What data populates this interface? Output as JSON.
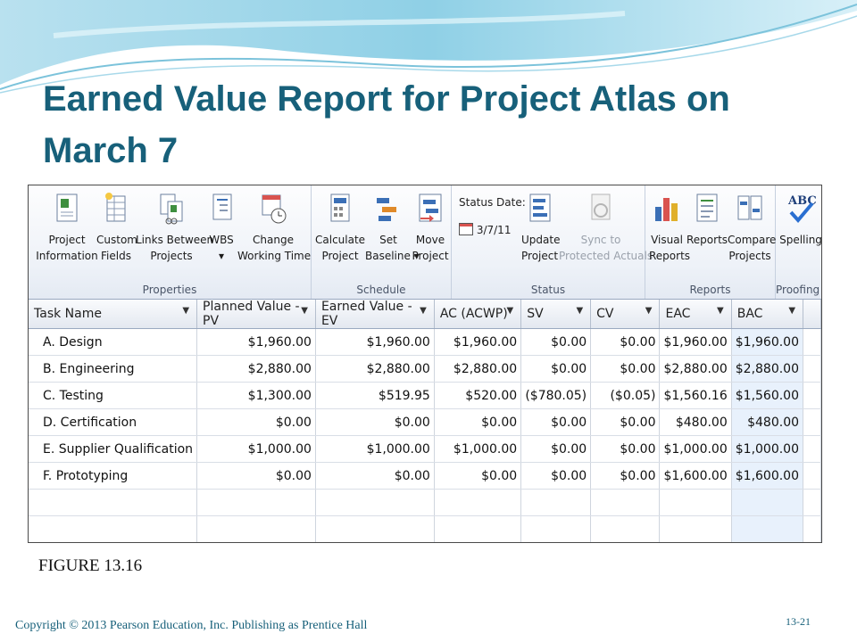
{
  "slide": {
    "title_line1": "Earned Value Report for Project Atlas on",
    "title_line2": "March 7",
    "figure": "FIGURE 13.16",
    "copyright": "Copyright © 2013 Pearson Education, Inc. Publishing as Prentice Hall",
    "page": "13-21"
  },
  "ribbon": {
    "groups": {
      "properties": "Properties",
      "schedule": "Schedule",
      "status": "Status",
      "reports": "Reports",
      "proofing": "Proofing"
    },
    "buttons": {
      "project_information": [
        "Project",
        "Information"
      ],
      "custom_fields": [
        "Custom",
        "Fields"
      ],
      "links_between_projects": [
        "Links Between",
        "Projects"
      ],
      "wbs": [
        "WBS",
        "▾"
      ],
      "change_working_time": [
        "Change",
        "Working Time"
      ],
      "calculate_project": [
        "Calculate",
        "Project"
      ],
      "set_baseline": [
        "Set",
        "Baseline ▾"
      ],
      "move_project": [
        "Move",
        "Project"
      ],
      "update_project": [
        "Update",
        "Project"
      ],
      "sync_protected_actuals": [
        "Sync to",
        "Protected Actuals"
      ],
      "visual_reports": [
        "Visual",
        "Reports"
      ],
      "reports": [
        "Reports",
        ""
      ],
      "compare_projects": [
        "Compare",
        "Projects"
      ],
      "spelling": [
        "Spelling",
        ""
      ]
    },
    "status_date_label": "Status Date:",
    "status_date_value": "3/7/11",
    "colors": {
      "accent": "#17607a",
      "ribbon_border": "#9aa9c0"
    }
  },
  "table": {
    "columns": [
      "Task Name",
      "Planned Value - PV",
      "Earned Value - EV",
      "AC (ACWP)",
      "SV",
      "CV",
      "EAC",
      "BAC"
    ],
    "rows": [
      [
        "A. Design",
        "$1,960.00",
        "$1,960.00",
        "$1,960.00",
        "$0.00",
        "$0.00",
        "$1,960.00",
        "$1,960.00"
      ],
      [
        "B. Engineering",
        "$2,880.00",
        "$2,880.00",
        "$2,880.00",
        "$0.00",
        "$0.00",
        "$2,880.00",
        "$2,880.00"
      ],
      [
        "C. Testing",
        "$1,300.00",
        "$519.95",
        "$520.00",
        "($780.05)",
        "($0.05)",
        "$1,560.16",
        "$1,560.00"
      ],
      [
        "D. Certification",
        "$0.00",
        "$0.00",
        "$0.00",
        "$0.00",
        "$0.00",
        "$480.00",
        "$480.00"
      ],
      [
        "E. Supplier Qualification",
        "$1,000.00",
        "$1,000.00",
        "$1,000.00",
        "$0.00",
        "$0.00",
        "$1,000.00",
        "$1,000.00"
      ],
      [
        "F. Prototyping",
        "$0.00",
        "$0.00",
        "$0.00",
        "$0.00",
        "$0.00",
        "$1,600.00",
        "$1,600.00"
      ]
    ]
  }
}
